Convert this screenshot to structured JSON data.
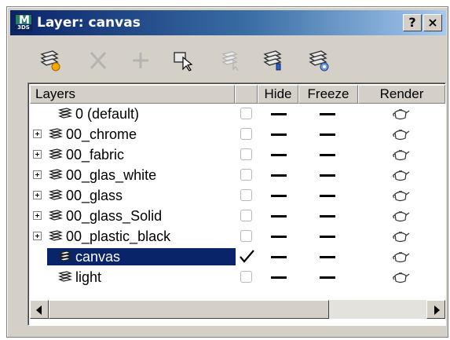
{
  "window": {
    "app_badge": "3DS",
    "app_badge_letter": "M",
    "title": "Layer: canvas",
    "help_label": "?",
    "close_label": "×"
  },
  "toolbar": {
    "buttons": [
      {
        "name": "create-layer",
        "icon": "new-layer-icon",
        "enabled": true
      },
      {
        "name": "delete-layer",
        "icon": "delete-icon",
        "enabled": false
      },
      {
        "name": "add-selection",
        "icon": "plus-icon",
        "enabled": false
      },
      {
        "name": "select-objects",
        "icon": "select-objects-icon",
        "enabled": true
      },
      {
        "name": "set-current",
        "icon": "set-current-icon",
        "enabled": false
      },
      {
        "name": "highlight-selected",
        "icon": "highlight-layer-icon",
        "enabled": true
      },
      {
        "name": "hide-all",
        "icon": "hide-layers-icon",
        "enabled": true
      }
    ]
  },
  "columns": {
    "layers": "Layers",
    "current": "",
    "hide": "Hide",
    "freeze": "Freeze",
    "render": "Render"
  },
  "rows": [
    {
      "label": "0 (default)",
      "expandable": false,
      "current": false,
      "selected": false
    },
    {
      "label": "00_chrome",
      "expandable": true,
      "current": false,
      "selected": false
    },
    {
      "label": "00_fabric",
      "expandable": true,
      "current": false,
      "selected": false
    },
    {
      "label": "00_glas_white",
      "expandable": true,
      "current": false,
      "selected": false
    },
    {
      "label": "00_glass",
      "expandable": true,
      "current": false,
      "selected": false
    },
    {
      "label": "00_glass_Solid",
      "expandable": true,
      "current": false,
      "selected": false
    },
    {
      "label": "00_plastic_black",
      "expandable": true,
      "current": false,
      "selected": false
    },
    {
      "label": "canvas",
      "expandable": false,
      "current": true,
      "selected": true
    },
    {
      "label": "light",
      "expandable": false,
      "current": false,
      "selected": false
    }
  ],
  "colors": {
    "title_bar_start": "#0a246a",
    "title_bar_end": "#a6caf0",
    "selection": "#0a246a",
    "dialog_face": "#d4d0c8"
  }
}
